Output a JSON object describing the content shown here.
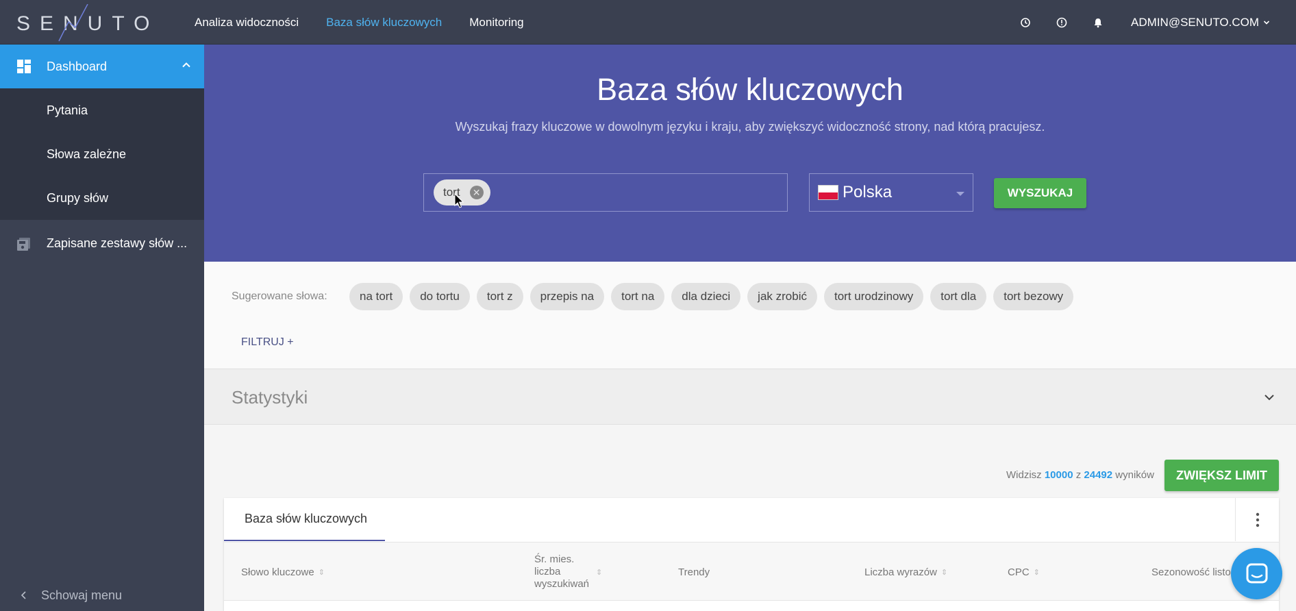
{
  "brand": {
    "logo_text": "SENUTO"
  },
  "topnav": {
    "items": [
      {
        "label": "Analiza widoczności",
        "active": false
      },
      {
        "label": "Baza słów kluczowych",
        "active": true
      },
      {
        "label": "Monitoring",
        "active": false
      }
    ],
    "icons": [
      "history-icon",
      "info-icon",
      "bell-icon"
    ],
    "user": "ADMIN@SENUTO.COM"
  },
  "sidebar": {
    "dashboard": "Dashboard",
    "subitems": [
      "Pytania",
      "Słowa zależne",
      "Grupy słów"
    ],
    "saved": "Zapisane zestawy słów ...",
    "collapse": "Schowaj menu"
  },
  "hero": {
    "title": "Baza słów kluczowych",
    "subtitle": "Wyszukaj frazy kluczowe w dowolnym języku i kraju, aby zwiększyć widoczność strony, nad którą pracujesz.",
    "chip": "tort",
    "country": "Polska",
    "search_button": "WYSZUKAJ"
  },
  "suggestions": {
    "label": "Sugerowane słowa:",
    "items": [
      "na tort",
      "do tortu",
      "tort z",
      "przepis na",
      "tort na",
      "dla dzieci",
      "jak zrobić",
      "tort urodzinowy",
      "tort dla",
      "tort bezowy"
    ],
    "filter": "FILTRUJ +"
  },
  "stats": {
    "title": "Statystyki"
  },
  "results": {
    "prefix": "Widzisz",
    "shown": "10000",
    "mid": "z",
    "total": "24492",
    "suffix": "wyników",
    "limit_button": "ZWIĘKSZ LIMIT"
  },
  "table": {
    "tab": "Baza słów kluczowych",
    "columns": {
      "keyword": "Słowo kluczowe",
      "avg": "Śr. mies. liczba wyszukiwań",
      "trends": "Trendy",
      "words": "Liczba wyrazów",
      "cpc": "CPC",
      "season": "Sezonowość listo"
    }
  },
  "colors": {
    "accent": "#2b9ae6",
    "hero": "#4f55a5",
    "sidebar": "#3b4152",
    "green": "#4caf50"
  }
}
